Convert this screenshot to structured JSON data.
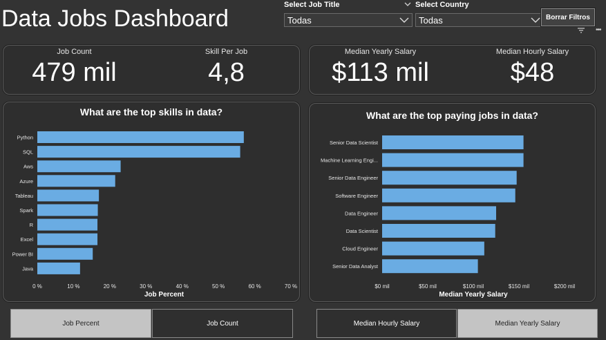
{
  "header": {
    "title": "Data Jobs Dashboard"
  },
  "filters": {
    "job_title": {
      "label": "Select Job Title",
      "value": "Todas"
    },
    "country": {
      "label": "Select Country",
      "value": "Todas"
    },
    "clear_button": "Borrar Filtros"
  },
  "kpis": {
    "job_count": {
      "label": "Job Count",
      "value": "479 mil"
    },
    "skill_per_job": {
      "label": "Skill Per Job",
      "value": "4,8"
    },
    "median_yearly": {
      "label": "Median Yearly Salary",
      "value": "$113 mil"
    },
    "median_hourly": {
      "label": "Median Hourly Salary",
      "value": "$48"
    }
  },
  "colors": {
    "bar": "#6aace3",
    "background": "#333333",
    "toggle_active": "#c4c4c4"
  },
  "chart_data": [
    {
      "type": "bar",
      "orientation": "horizontal",
      "title": "What are the top skills in data?",
      "xlabel": "Job Percent",
      "categories": [
        "Python",
        "SQL",
        "Aws",
        "Azure",
        "Tableau",
        "Spark",
        "R",
        "Excel",
        "Power BI",
        "Java"
      ],
      "values": [
        57,
        56,
        23,
        21.5,
        17,
        16.7,
        16.6,
        16.6,
        15.3,
        11.8
      ],
      "xlim": [
        0,
        70
      ],
      "ticks": [
        "0 %",
        "10 %",
        "20 %",
        "30 %",
        "40 %",
        "50 %",
        "60 %",
        "70 %"
      ]
    },
    {
      "type": "bar",
      "orientation": "horizontal",
      "title": "What are the top paying jobs in data?",
      "xlabel": "Median Yearly Salary",
      "categories": [
        "Senior Data Scientist",
        "Machine Learning Engi...",
        "Senior Data Engineer",
        "Software Engineer",
        "Data Engineer",
        "Data Scientist",
        "Cloud Engineer",
        "Senior Data Analyst"
      ],
      "values": [
        155000,
        155000,
        147500,
        146000,
        125000,
        124000,
        112000,
        105000
      ],
      "xlim": [
        0,
        200000
      ],
      "ticks": [
        "$0 mil",
        "$50 mil",
        "$100 mil",
        "$150 mil",
        "$200 mil"
      ]
    }
  ],
  "toggles": {
    "left": [
      {
        "label": "Job Percent",
        "active": true
      },
      {
        "label": "Job Count",
        "active": false
      }
    ],
    "right": [
      {
        "label": "Median Hourly Salary",
        "active": false
      },
      {
        "label": "Median Yearly Salary",
        "active": true
      }
    ]
  }
}
